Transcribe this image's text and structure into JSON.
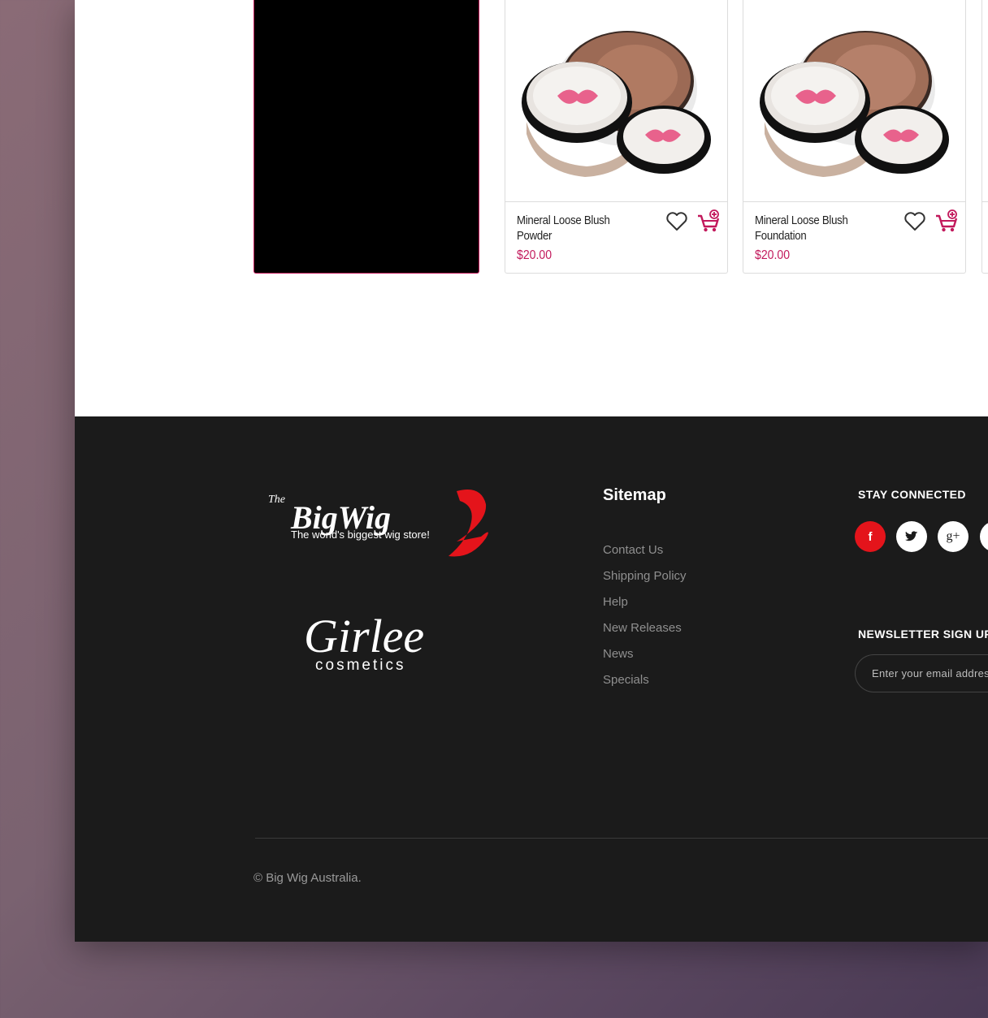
{
  "products": [
    {
      "title": "Mineral Loose Blush Powder",
      "price": "$20.00"
    },
    {
      "title": "Mineral Loose Blush Foundation",
      "price": "$20.00"
    }
  ],
  "colors": {
    "accent": "#c2185b",
    "footer_bg": "#1b1b1b",
    "facebook": "#e4141b"
  },
  "footer": {
    "logo_bigwig": {
      "the": "The",
      "brand": "BigWig",
      "tagline": "The world's biggest wig store!"
    },
    "logo_girlee": {
      "brand": "Girlee",
      "sub": "cosmetics"
    },
    "sitemap_title": "Sitemap",
    "sitemap_links": [
      "Contact Us",
      "Shipping Policy",
      "Help",
      "New Releases",
      "News",
      "Specials"
    ],
    "stay_connected": "STAY CONNECTED",
    "social_icons": [
      "facebook-icon",
      "twitter-icon",
      "google-plus-icon",
      "social-icon"
    ],
    "social_glyphs": {
      "facebook": "f",
      "google": "g+"
    },
    "newsletter_title": "NEWSLETTER SIGN UP",
    "email_placeholder": "Enter your email address",
    "copyright": "© Big Wig Australia."
  }
}
